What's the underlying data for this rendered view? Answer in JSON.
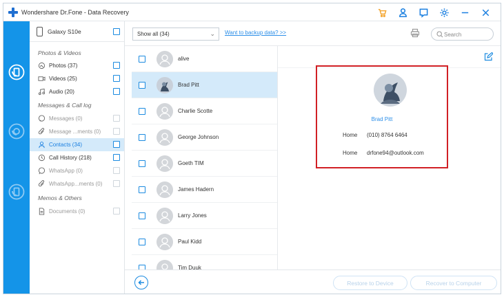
{
  "window": {
    "title": "Wondershare Dr.Fone - Data Recovery"
  },
  "titlebar_icons": [
    "cart-icon",
    "user-icon",
    "feedback-icon",
    "settings-icon",
    "minimize-icon",
    "close-icon"
  ],
  "colors": {
    "accent": "#1494e8",
    "link": "#2b8ee8",
    "highlight_border": "#d11f24",
    "selected_row": "#d4eafa"
  },
  "device": {
    "name": "Galaxy S10e"
  },
  "categories": {
    "photos_videos_title": "Photos & Videos",
    "messages_title": "Messages & Call log",
    "memos_title": "Memos & Others",
    "items": [
      {
        "label": "Photos (37)"
      },
      {
        "label": "Videos (25)"
      },
      {
        "label": "Audio (20)"
      },
      {
        "label": "Messages (0)"
      },
      {
        "label": "Message ...ments (0)"
      },
      {
        "label": "Contacts (34)"
      },
      {
        "label": "Call History (218)"
      },
      {
        "label": "WhatsApp (0)"
      },
      {
        "label": "WhatsApp...ments (0)"
      },
      {
        "label": "Documents (0)"
      }
    ]
  },
  "toolbar": {
    "filter_value": "Show all (34)",
    "backup_link": "Want to backup data? >>",
    "search_placeholder": "Search"
  },
  "contacts": [
    {
      "name": "alive"
    },
    {
      "name": "Brad Pitt"
    },
    {
      "name": "Charlie Scotte"
    },
    {
      "name": "George Johnson"
    },
    {
      "name": "Goeth TIM"
    },
    {
      "name": "James Hadern"
    },
    {
      "name": "Larry Jones"
    },
    {
      "name": "Paul Kidd"
    },
    {
      "name": "Tim Duuk"
    }
  ],
  "detail": {
    "name": "Brad Pitt",
    "fields": [
      {
        "label": "Home",
        "value": "(010) 8764 6464"
      },
      {
        "label": "Home",
        "value": "drfone94@outlook.com"
      }
    ]
  },
  "bottom": {
    "restore_device": "Restore to Device",
    "restore_computer": "Recover to Computer"
  }
}
